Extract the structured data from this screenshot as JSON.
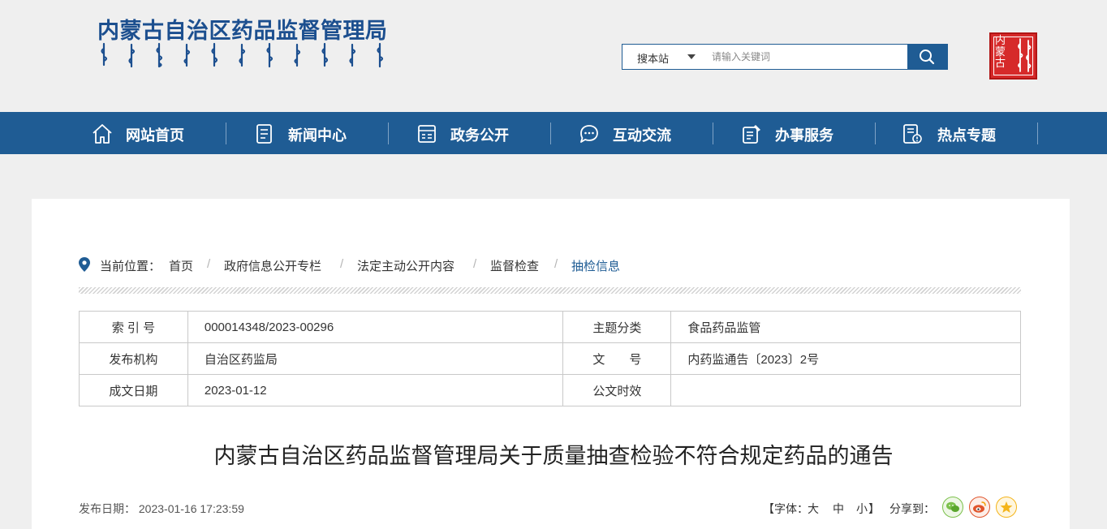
{
  "header": {
    "title": "内蒙古自治区药品监督管理局",
    "mongolian_logo_icon": "mongolian-script-logo",
    "seal_text": "内蒙古",
    "seal_icon": "inner-mongolia-seal"
  },
  "search": {
    "scope_label": "搜本站",
    "placeholder": "请输入关键词",
    "button_icon": "search-icon"
  },
  "nav": {
    "items": [
      {
        "label": "网站首页",
        "icon": "home-icon"
      },
      {
        "label": "新闻中心",
        "icon": "news-icon"
      },
      {
        "label": "政务公开",
        "icon": "government-icon"
      },
      {
        "label": "互动交流",
        "icon": "chat-icon"
      },
      {
        "label": "办事服务",
        "icon": "service-icon"
      },
      {
        "label": "热点专题",
        "icon": "hot-topic-icon"
      }
    ]
  },
  "breadcrumb": {
    "prefix": "当前位置：",
    "items": [
      "首页",
      "政府信息公开专栏",
      "法定主动公开内容",
      "监督检查",
      "抽检信息"
    ],
    "separator": "/"
  },
  "meta": {
    "rows": [
      {
        "k1": "索 引 号",
        "v1": "000014348/2023-00296",
        "k2": "主题分类",
        "v2": "食品药品监管"
      },
      {
        "k1": "发布机构",
        "v1": "自治区药监局",
        "k2": "文　　号",
        "v2": "内药监通告〔2023〕2号"
      },
      {
        "k1": "成文日期",
        "v1": "2023-01-12",
        "k2": "公文时效",
        "v2": ""
      }
    ]
  },
  "article": {
    "title": "内蒙古自治区药品监督管理局关于质量抽查检验不符合规定药品的通告",
    "pubdate_label": "发布日期：",
    "pubdate": "2023-01-16 17:23:59",
    "font_open": "【字体：",
    "font_large": "大",
    "font_medium": "中",
    "font_small": "小",
    "font_close": "】",
    "share_label": "分享到：",
    "share_icons": [
      "wechat-icon",
      "weibo-icon",
      "favorite-icon"
    ]
  },
  "colors": {
    "brand_blue": "#1f5c94",
    "seal_red": "#d62a2a",
    "wechat_green": "#7bc04b",
    "weibo_red": "#e0542b",
    "favorite_yellow": "#f4b41a"
  }
}
